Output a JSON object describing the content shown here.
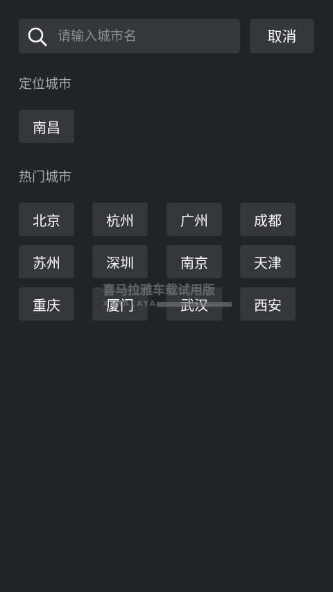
{
  "search": {
    "placeholder": "请输入城市名",
    "value": "",
    "cancel_label": "取消"
  },
  "located": {
    "title": "定位城市",
    "city": "南昌"
  },
  "hot": {
    "title": "热门城市",
    "cities": [
      "北京",
      "杭州",
      "广州",
      "成都",
      "苏州",
      "深圳",
      "南京",
      "天津",
      "重庆",
      "厦门",
      "武汉",
      "西安"
    ]
  },
  "watermark": {
    "text": "喜马拉雅车载试用版",
    "sub": "XIMALAYA"
  },
  "colors": {
    "background": "#212326",
    "button": "#35373b",
    "section_title": "#a5a7ab",
    "placeholder": "#8a8c90"
  }
}
